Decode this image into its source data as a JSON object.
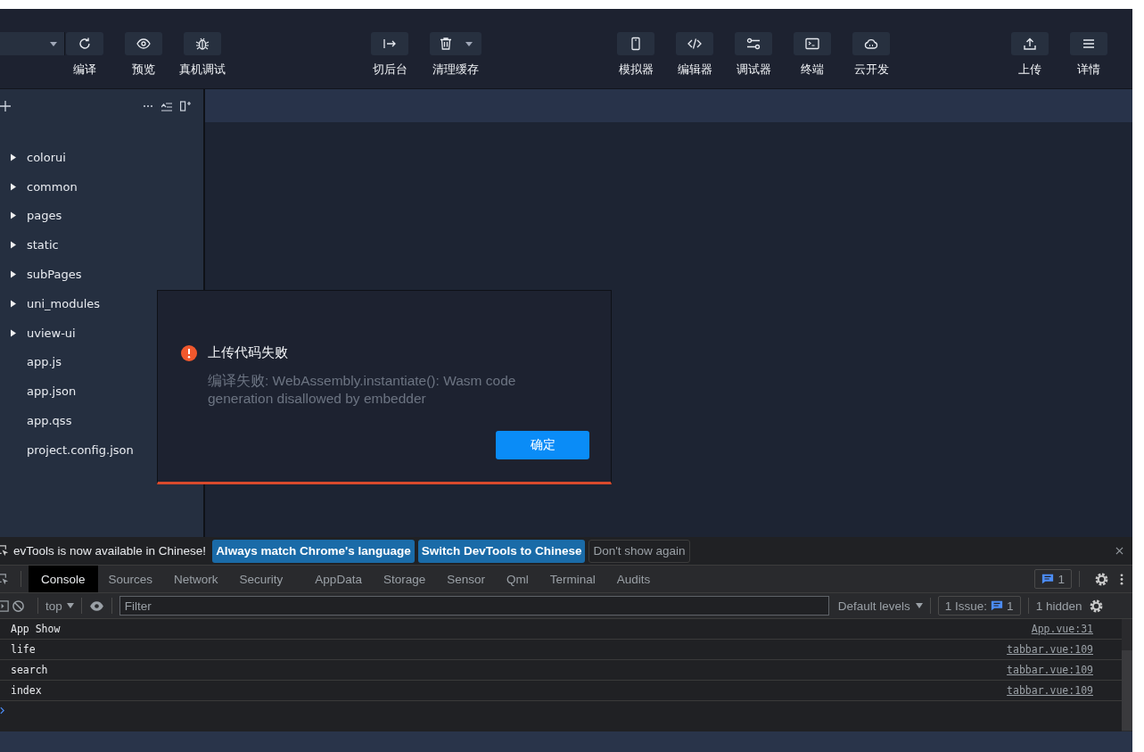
{
  "toolbar": {
    "groups": [
      {
        "items": [
          {
            "label": "编译",
            "has_menu": false
          },
          {
            "label": "预览",
            "has_menu": false
          },
          {
            "label": "真机调试",
            "has_menu": false
          }
        ]
      },
      {
        "items": [
          {
            "label": "切后台",
            "has_menu": false
          },
          {
            "label": "清理缓存",
            "has_menu": true
          }
        ]
      },
      {
        "items": [
          {
            "label": "模拟器",
            "has_menu": false
          },
          {
            "label": "编辑器",
            "has_menu": false
          },
          {
            "label": "调试器",
            "has_menu": false
          },
          {
            "label": "终端",
            "has_menu": false
          },
          {
            "label": "云开发",
            "has_menu": false
          }
        ]
      },
      {
        "items": [
          {
            "label": "上传",
            "has_menu": false
          },
          {
            "label": "详情",
            "has_menu": false
          }
        ]
      }
    ]
  },
  "file_tree": {
    "items": [
      {
        "name": "colorui",
        "kind": "folder",
        "expanded": false
      },
      {
        "name": "common",
        "kind": "folder",
        "expanded": false
      },
      {
        "name": "pages",
        "kind": "folder",
        "expanded": false
      },
      {
        "name": "static",
        "kind": "folder",
        "expanded": false
      },
      {
        "name": "subPages",
        "kind": "folder",
        "expanded": false
      },
      {
        "name": "uni_modules",
        "kind": "folder",
        "expanded": false
      },
      {
        "name": "uview-ui",
        "kind": "folder",
        "expanded": false
      },
      {
        "name": "app.js",
        "kind": "file"
      },
      {
        "name": "app.json",
        "kind": "file"
      },
      {
        "name": "app.qss",
        "kind": "file"
      },
      {
        "name": "project.config.json",
        "kind": "file"
      }
    ]
  },
  "dialog": {
    "title": "上传代码失败",
    "message": "编译失败: WebAssembly.instantiate(): Wasm code generation disallowed by embedder",
    "buttons": [
      "确定"
    ]
  },
  "devtools": {
    "infobar": {
      "message": "evTools is now available in Chinese!",
      "actions": [
        {
          "label": "Always match Chrome's language",
          "kind": "primary"
        },
        {
          "label": "Switch DevTools to Chinese",
          "kind": "primary"
        },
        {
          "label": "Don't show again",
          "kind": "secondary"
        }
      ]
    },
    "tabs": [
      {
        "label": "Console",
        "selected": true
      },
      {
        "label": "Sources",
        "selected": false
      },
      {
        "label": "Network",
        "selected": false
      },
      {
        "label": "Security",
        "selected": false
      },
      {
        "label": "AppData",
        "selected": false
      },
      {
        "label": "Storage",
        "selected": false
      },
      {
        "label": "Sensor",
        "selected": false
      },
      {
        "label": "Qml",
        "selected": false
      },
      {
        "label": "Terminal",
        "selected": false
      },
      {
        "label": "Audits",
        "selected": false
      }
    ],
    "issues_badge": "1",
    "context": "top",
    "filter": {
      "placeholder": "Filter"
    },
    "levels": "Default levels",
    "issue_label": "1 Issue:",
    "issue_count": "1",
    "hidden": "1 hidden",
    "logs": [
      {
        "message": "App Show",
        "source": "App.vue:31"
      },
      {
        "message": "life",
        "source": "tabbar.vue:109"
      },
      {
        "message": "search",
        "source": "tabbar.vue:109"
      },
      {
        "message": "index",
        "source": "tabbar.vue:109"
      }
    ]
  }
}
